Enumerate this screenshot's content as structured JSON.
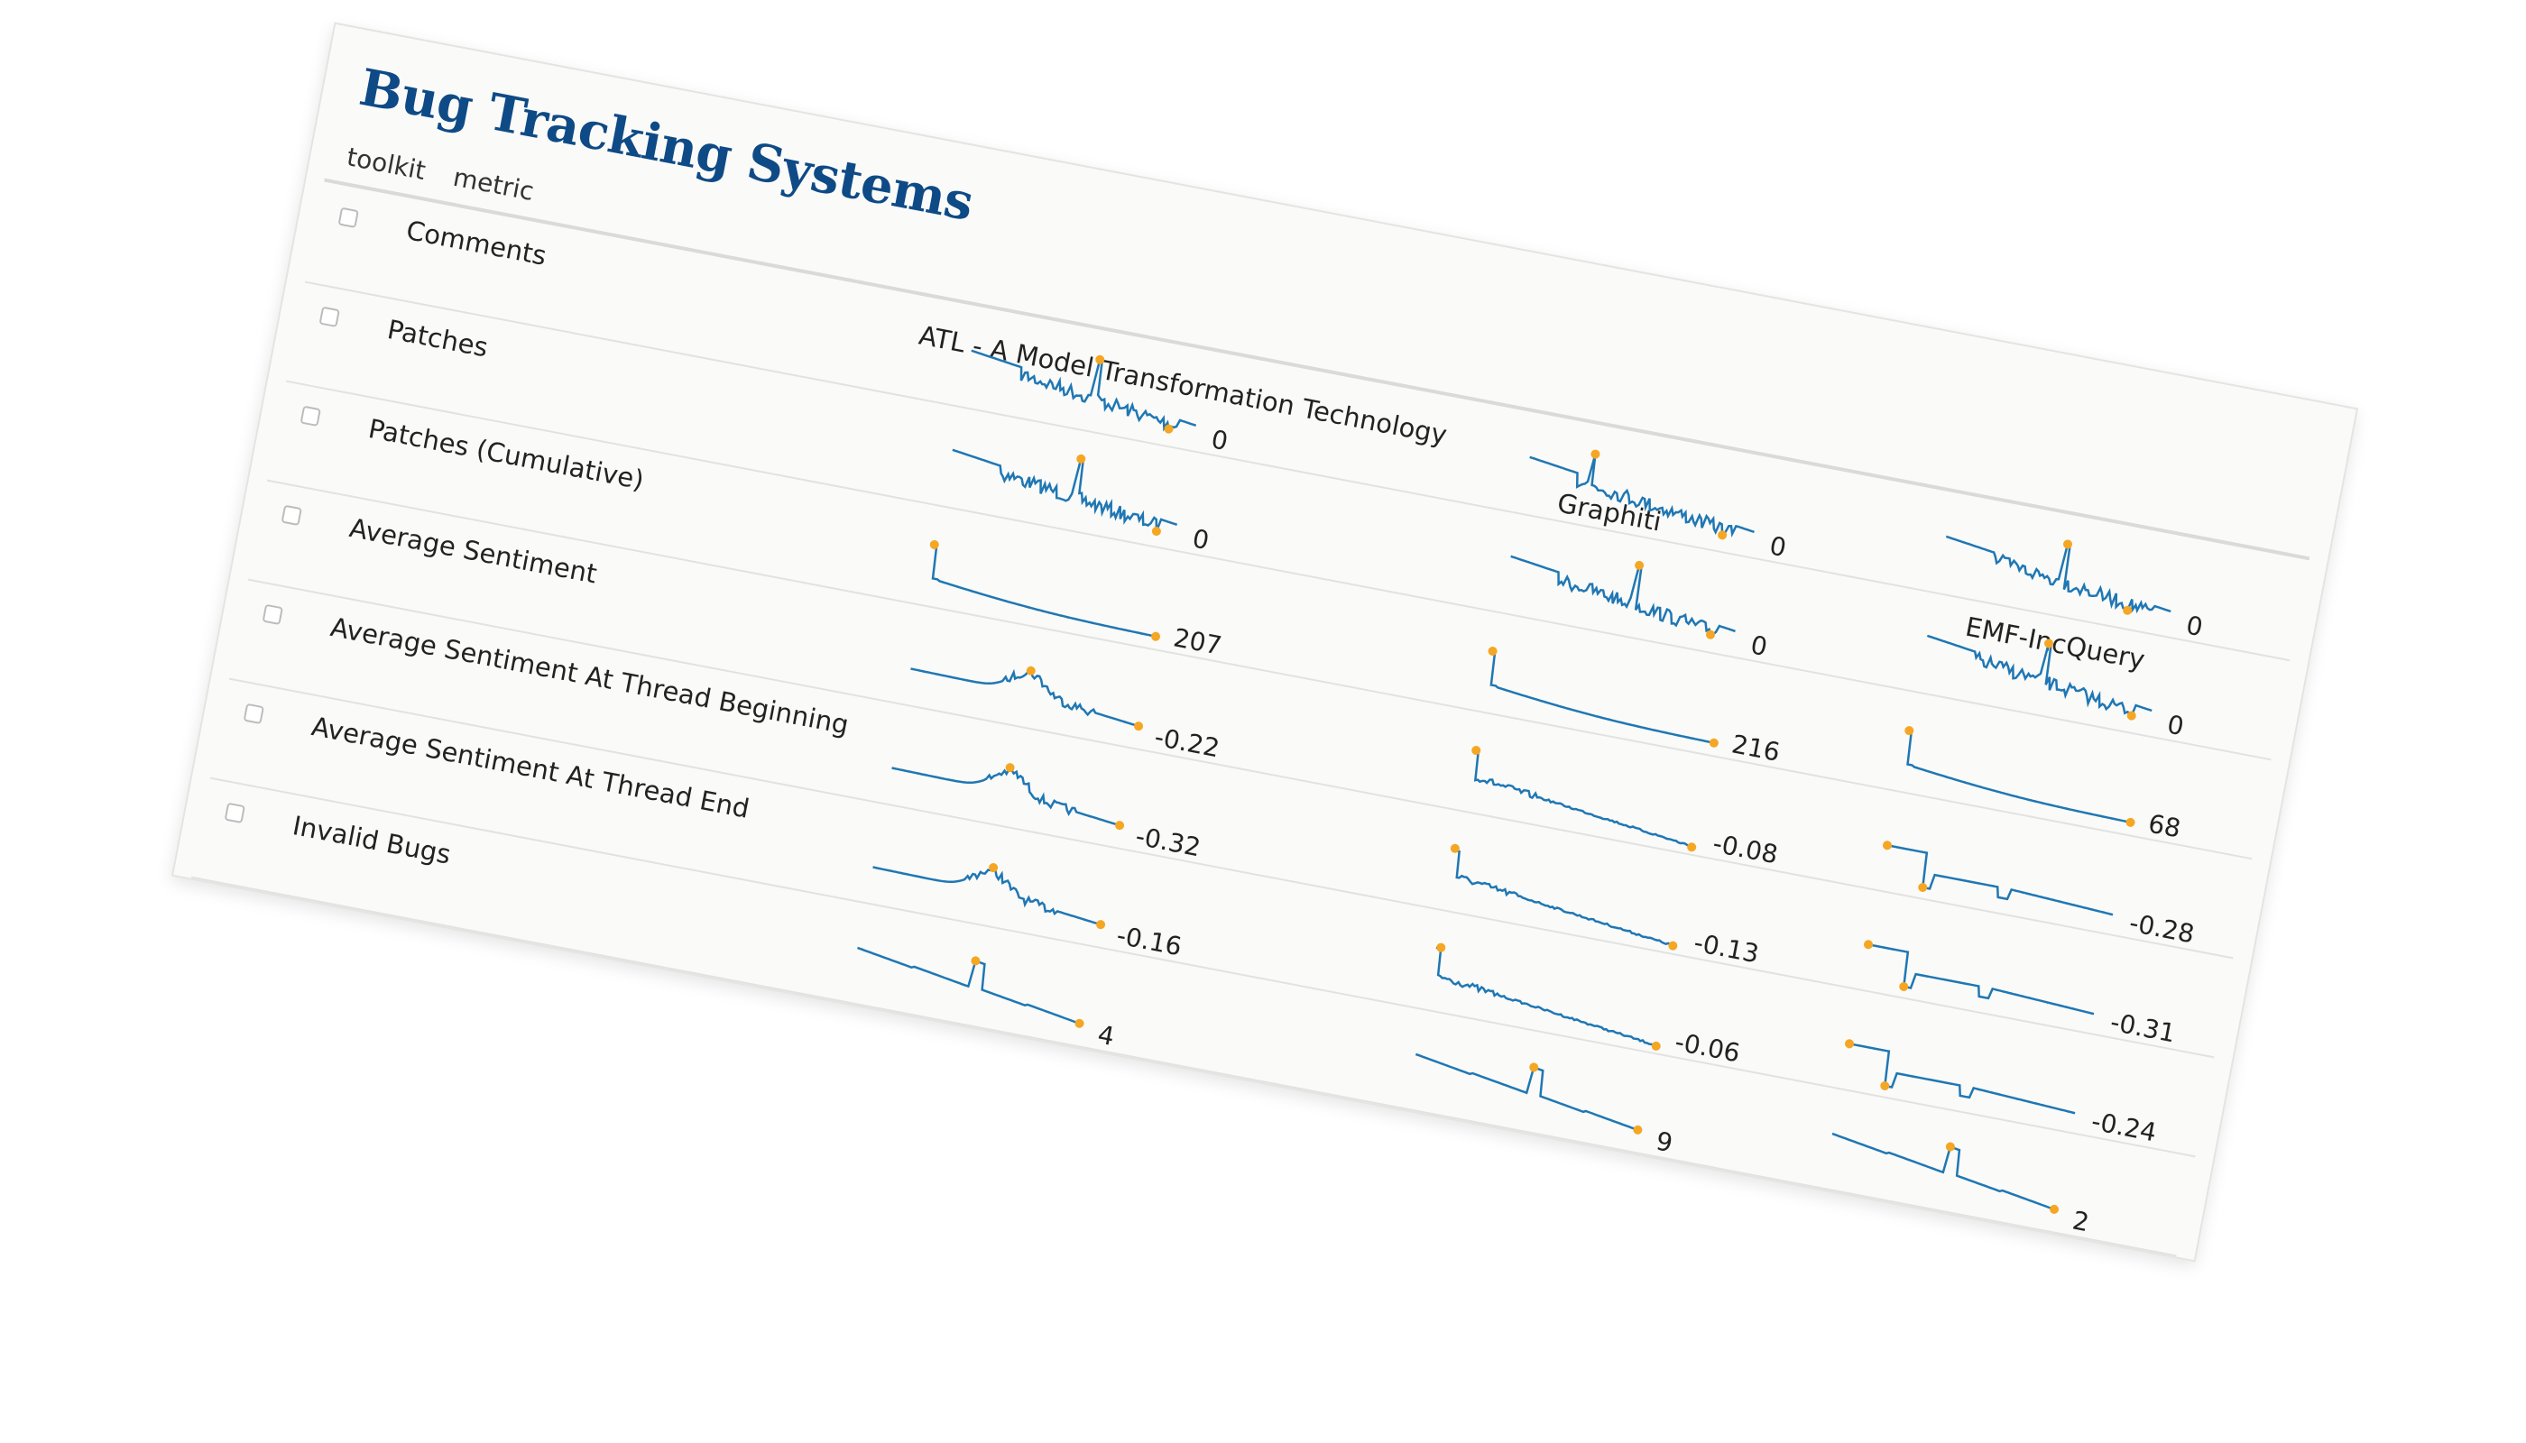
{
  "page": {
    "title": "Bug Tracking Systems",
    "column_headers": [
      "toolkit",
      "metric"
    ]
  },
  "colors": {
    "title": "#0e4a86",
    "spark_line": "#1f77b4",
    "spark_marker": "#f5a623"
  },
  "chart_data": {
    "type": "sparkline-table",
    "toolkits": [
      "ATL - A Model Transformation Technology",
      "Graphiti",
      "EMF-IncQuery"
    ],
    "metrics": [
      "Comments",
      "Patches",
      "Patches (Cumulative)",
      "Average Sentiment",
      "Average Sentiment At Thread Beginning",
      "Average Sentiment At Thread End",
      "Invalid Bugs"
    ],
    "cells": [
      [
        {
          "label": "0",
          "kind": "spike",
          "spike_at": 0.55
        },
        {
          "label": "0",
          "kind": "spike",
          "spike_at": 0.55
        },
        {
          "label": "207",
          "kind": "cumulative"
        },
        {
          "label": "-0.22",
          "kind": "hump"
        },
        {
          "label": "-0.32",
          "kind": "hump"
        },
        {
          "label": "-0.16",
          "kind": "hump"
        },
        {
          "label": "4",
          "kind": "steps"
        }
      ],
      [
        {
          "label": "0",
          "kind": "spike",
          "spike_at": 0.27
        },
        {
          "label": "0",
          "kind": "spike",
          "spike_at": 0.55
        },
        {
          "label": "216",
          "kind": "cumulative"
        },
        {
          "label": "-0.08",
          "kind": "decline"
        },
        {
          "label": "-0.13",
          "kind": "decline"
        },
        {
          "label": "-0.06",
          "kind": "decline"
        },
        {
          "label": "9",
          "kind": "steps"
        }
      ],
      [
        {
          "label": "0",
          "kind": "spike",
          "spike_at": 0.52
        },
        {
          "label": "0",
          "kind": "spike",
          "spike_at": 0.52
        },
        {
          "label": "68",
          "kind": "cumulative"
        },
        {
          "label": "-0.28",
          "kind": "steps2"
        },
        {
          "label": "-0.31",
          "kind": "steps2"
        },
        {
          "label": "-0.24",
          "kind": "steps2"
        },
        {
          "label": "2",
          "kind": "steps"
        }
      ]
    ]
  }
}
